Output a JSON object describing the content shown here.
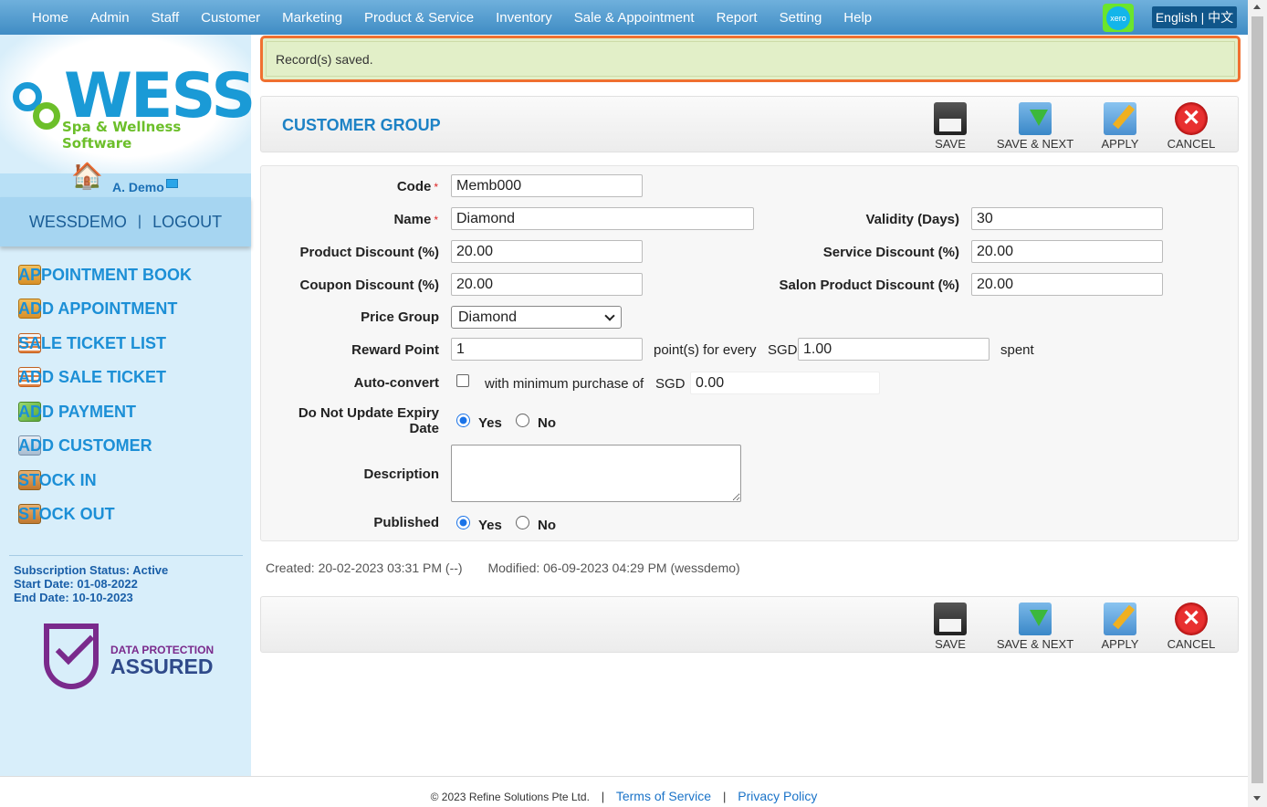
{
  "nav": {
    "items": [
      "Home",
      "Admin",
      "Staff",
      "Customer",
      "Marketing",
      "Product & Service",
      "Inventory",
      "Sale & Appointment",
      "Report",
      "Setting",
      "Help"
    ],
    "xero_label": "xero",
    "language": "English | 中文"
  },
  "sidebar": {
    "logo_text": "WESS",
    "logo_tagline": "Spa & Wellness Software",
    "user_name": "A. Demo",
    "account": "WESSDEMO",
    "account_sep": "|",
    "logout": "LOGOUT",
    "menu": [
      {
        "label": "APPOINTMENT BOOK",
        "icon": "appointment-book-icon"
      },
      {
        "label": "ADD APPOINTMENT",
        "icon": "appointment-book-icon"
      },
      {
        "label": "SALE TICKET LIST",
        "icon": "sale-ticket-icon"
      },
      {
        "label": "ADD SALE TICKET",
        "icon": "sale-ticket-icon"
      },
      {
        "label": "ADD PAYMENT",
        "icon": "payment-icon"
      },
      {
        "label": "ADD CUSTOMER",
        "icon": "customer-card-icon"
      },
      {
        "label": "STOCK IN",
        "icon": "stock-box-icon"
      },
      {
        "label": "STOCK OUT",
        "icon": "stock-box-icon"
      }
    ],
    "subscription_status": "Subscription Status: Active",
    "start_date": "Start Date: 01-08-2022",
    "end_date": "End Date: 10-10-2023",
    "badge_line1": "DATA PROTECTION",
    "badge_line2": "ASSURED"
  },
  "message": "Record(s) saved.",
  "page_title": "CUSTOMER GROUP",
  "toolbar": {
    "save": "SAVE",
    "save_next": "SAVE & NEXT",
    "apply": "APPLY",
    "cancel": "CANCEL"
  },
  "form": {
    "code_label": "Code",
    "code_value": "Memb000",
    "name_label": "Name",
    "name_value": "Diamond",
    "required_mark": "*",
    "validity_label": "Validity (Days)",
    "validity_value": "30",
    "product_discount_label": "Product Discount (%)",
    "product_discount_value": "20.00",
    "service_discount_label": "Service Discount (%)",
    "service_discount_value": "20.00",
    "coupon_discount_label": "Coupon Discount (%)",
    "coupon_discount_value": "20.00",
    "salon_discount_label": "Salon Product Discount (%)",
    "salon_discount_value": "20.00",
    "price_group_label": "Price Group",
    "price_group_value": "Diamond",
    "reward_point_label": "Reward Point",
    "reward_point_value": "1",
    "points_for_every": "point(s) for every",
    "currency": "SGD",
    "reward_amount_value": "1.00",
    "spent": "spent",
    "auto_convert_label": "Auto-convert",
    "auto_convert_checked": false,
    "min_purchase_text": "with minimum purchase of",
    "min_purchase_value": "0.00",
    "no_update_expiry_label1": "Do Not Update Expiry",
    "no_update_expiry_label2": "Date",
    "no_update_expiry_value": "Yes",
    "description_label": "Description",
    "description_value": "",
    "published_label": "Published",
    "published_value": "Yes",
    "yes": "Yes",
    "no": "No"
  },
  "meta": {
    "created": "Created: 20-02-2023 03:31 PM (--)",
    "modified": "Modified: 06-09-2023 04:29 PM (wessdemo)"
  },
  "footer": {
    "copyright": "© 2023 Refine Solutions Pte Ltd.",
    "sep": "|",
    "terms": "Terms of Service",
    "privacy": "Privacy Policy"
  }
}
